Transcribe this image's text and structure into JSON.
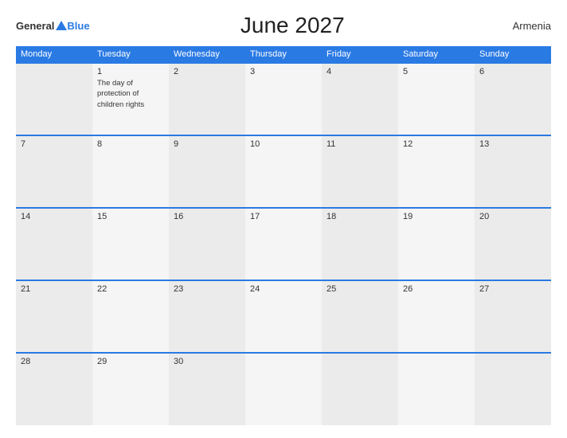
{
  "header": {
    "logo_general": "General",
    "logo_blue": "Blue",
    "title": "June 2027",
    "country": "Armenia"
  },
  "calendar": {
    "weekdays": [
      "Monday",
      "Tuesday",
      "Wednesday",
      "Thursday",
      "Friday",
      "Saturday",
      "Sunday"
    ],
    "weeks": [
      [
        {
          "day": "",
          "empty": true
        },
        {
          "day": "1",
          "holiday": "The day of protection of children rights"
        },
        {
          "day": "2"
        },
        {
          "day": "3"
        },
        {
          "day": "4"
        },
        {
          "day": "5"
        },
        {
          "day": "6"
        }
      ],
      [
        {
          "day": "7"
        },
        {
          "day": "8"
        },
        {
          "day": "9"
        },
        {
          "day": "10"
        },
        {
          "day": "11"
        },
        {
          "day": "12"
        },
        {
          "day": "13"
        }
      ],
      [
        {
          "day": "14"
        },
        {
          "day": "15"
        },
        {
          "day": "16"
        },
        {
          "day": "17"
        },
        {
          "day": "18"
        },
        {
          "day": "19"
        },
        {
          "day": "20"
        }
      ],
      [
        {
          "day": "21"
        },
        {
          "day": "22"
        },
        {
          "day": "23"
        },
        {
          "day": "24"
        },
        {
          "day": "25"
        },
        {
          "day": "26"
        },
        {
          "day": "27"
        }
      ],
      [
        {
          "day": "28"
        },
        {
          "day": "29"
        },
        {
          "day": "30"
        },
        {
          "day": "",
          "empty": true
        },
        {
          "day": "",
          "empty": true
        },
        {
          "day": "",
          "empty": true
        },
        {
          "day": "",
          "empty": true
        }
      ]
    ]
  }
}
